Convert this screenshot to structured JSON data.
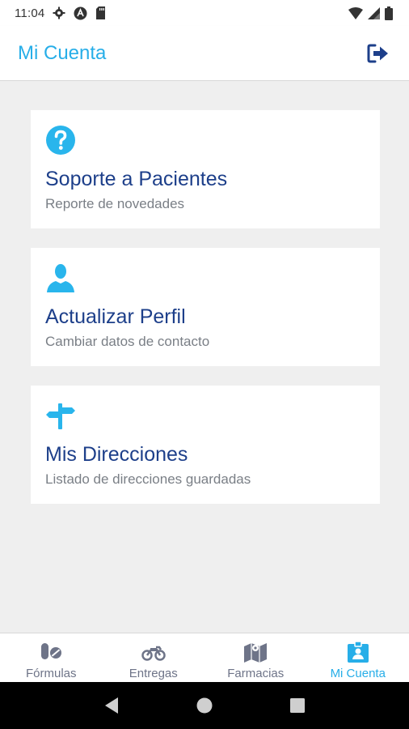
{
  "status_bar": {
    "time": "11:04"
  },
  "app_bar": {
    "title": "Mi Cuenta",
    "logout_icon": "logout-icon"
  },
  "cards": [
    {
      "icon": "help-circle-icon",
      "title": "Soporte a Pacientes",
      "subtitle": "Reporte de novedades"
    },
    {
      "icon": "person-icon",
      "title": "Actualizar Perfil",
      "subtitle": "Cambiar datos de contacto"
    },
    {
      "icon": "signpost-icon",
      "title": "Mis Direcciones",
      "subtitle": "Listado de direcciones guardadas"
    }
  ],
  "bottom_nav": {
    "items": [
      {
        "label": "Fórmulas",
        "icon": "pills-icon",
        "active": false
      },
      {
        "label": "Entregas",
        "icon": "motorcycle-icon",
        "active": false
      },
      {
        "label": "Farmacias",
        "icon": "map-icon",
        "active": false
      },
      {
        "label": "Mi Cuenta",
        "icon": "id-badge-icon",
        "active": true
      }
    ]
  },
  "colors": {
    "accent": "#27aee8",
    "card_title": "#1d3f8a",
    "subtitle": "#7a7f86",
    "nav_inactive": "#6e7488",
    "background": "#efefef"
  }
}
